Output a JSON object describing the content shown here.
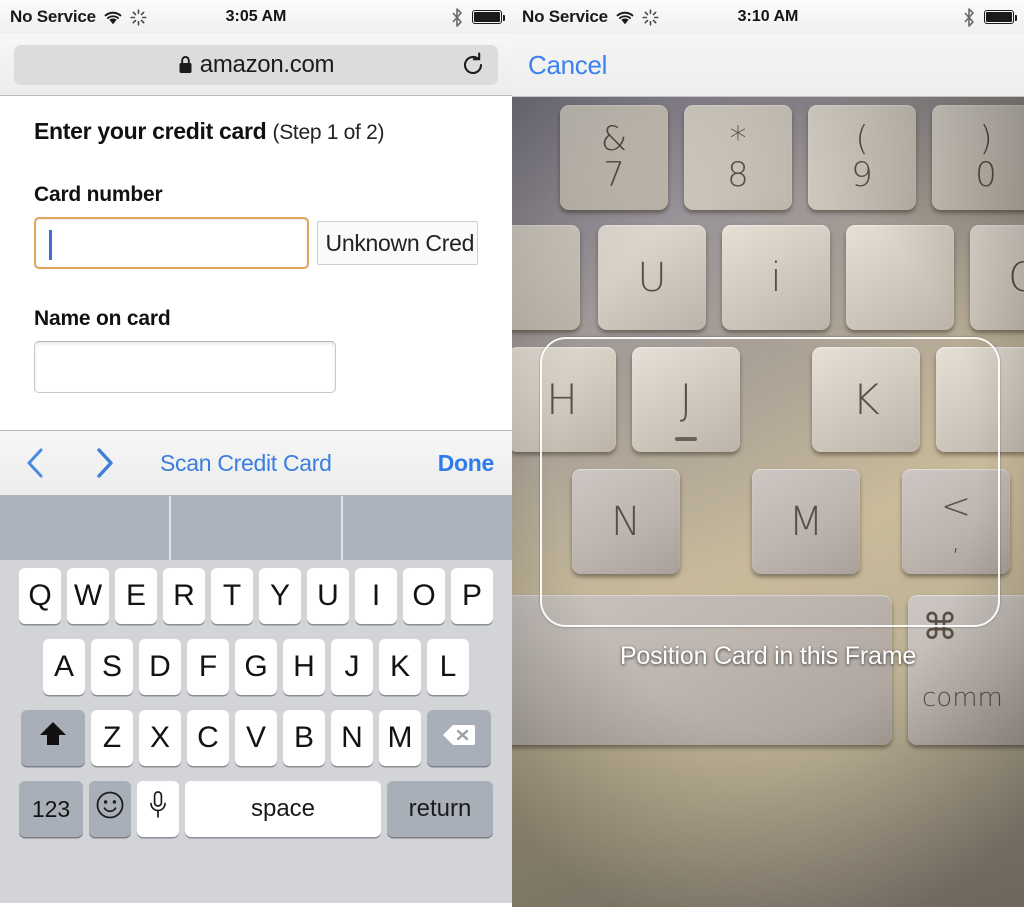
{
  "left_panel": {
    "status_bar": {
      "carrier": "No Service",
      "time": "3:05 AM",
      "wifi_icon": "wifi-icon",
      "activity_icon": "activity-spinner-icon",
      "bluetooth_icon": "bluetooth-icon",
      "battery_icon": "battery-full-icon"
    },
    "browser": {
      "lock_icon": "lock-icon",
      "url": "amazon.com",
      "reload_icon": "reload-icon"
    },
    "form": {
      "title": "Enter your credit card",
      "step": "(Step 1 of 2)",
      "card_number_label": "Card number",
      "card_number_value": "",
      "card_type_value": "Unknown Cred",
      "name_label": "Name on card",
      "name_value": ""
    },
    "accessory_bar": {
      "prev_icon": "chevron-left-icon",
      "next_icon": "chevron-right-icon",
      "scan_label": "Scan Credit Card",
      "done_label": "Done"
    },
    "keyboard": {
      "predictions": [
        "",
        "",
        ""
      ],
      "row1": [
        "Q",
        "W",
        "E",
        "R",
        "T",
        "Y",
        "U",
        "I",
        "O",
        "P"
      ],
      "row2": [
        "A",
        "S",
        "D",
        "F",
        "G",
        "H",
        "J",
        "K",
        "L"
      ],
      "row3": [
        "Z",
        "X",
        "C",
        "V",
        "B",
        "N",
        "M"
      ],
      "shift_icon": "shift-arrow-icon",
      "delete_icon": "backspace-icon",
      "numbers_label": "123",
      "emoji_icon": "emoji-smiley-icon",
      "dictation_icon": "microphone-icon",
      "space_label": "space",
      "return_label": "return"
    }
  },
  "right_panel": {
    "status_bar": {
      "carrier": "No Service",
      "time": "3:10 AM",
      "wifi_icon": "wifi-icon",
      "activity_icon": "activity-spinner-icon",
      "bluetooth_icon": "bluetooth-icon",
      "battery_icon": "battery-full-icon"
    },
    "nav": {
      "cancel_label": "Cancel"
    },
    "scanner": {
      "caption": "Position Card in this Frame",
      "frame_name": "card-scan-frame",
      "camera_subject_keys": [
        "&\n7",
        "*\n8",
        "(\n9",
        "U",
        "i",
        "O",
        "H",
        "J",
        "K",
        "N",
        "M",
        "<",
        ",",
        "⌘ comm"
      ]
    }
  },
  "colors": {
    "accent_blue": "#3b7de0",
    "focus_orange": "#e2a35c",
    "caret_blue": "#3a6fd8",
    "keyboard_bg": "#d2d4d8",
    "prediction_bg": "#aab2bc"
  }
}
